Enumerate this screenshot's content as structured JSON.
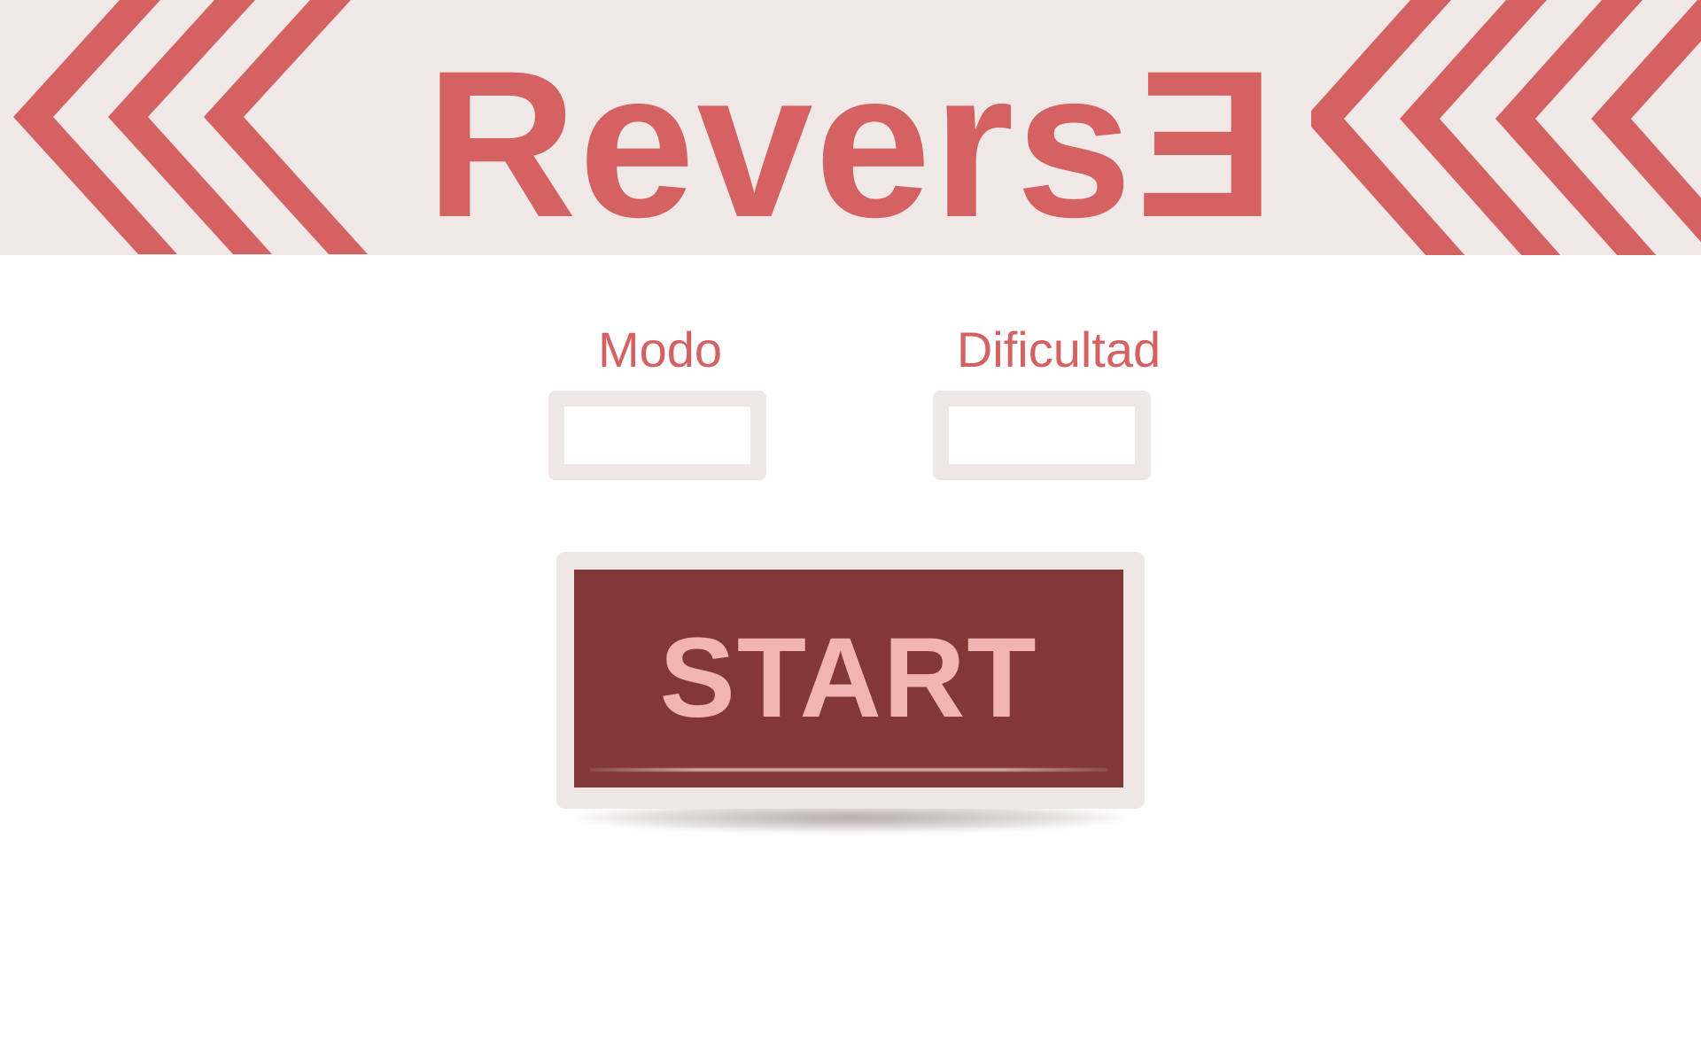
{
  "app": {
    "title_main": "Revers",
    "title_reversed_letter": "E"
  },
  "selectors": {
    "mode_label": "Modo",
    "difficulty_label": "Dificultad",
    "mode_value": "",
    "difficulty_value": ""
  },
  "start_button": {
    "label": "START"
  },
  "icons": {
    "left_decoration": "triple-chevron-left-icon",
    "right_decoration": "triple-chevron-left-icon"
  },
  "colors": {
    "accent": "#d46262",
    "banner_bg": "#f0e8e7",
    "button_face": "#833737",
    "button_text": "#f2b3b3",
    "frame": "#efe7e5"
  }
}
